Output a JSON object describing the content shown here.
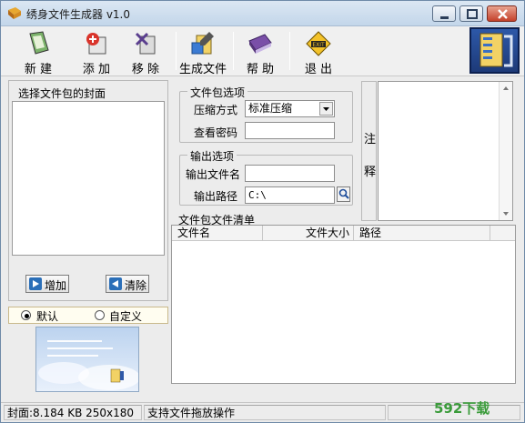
{
  "window": {
    "title": "绣身文件生成器 v1.0"
  },
  "toolbar": {
    "items": [
      {
        "label": "新 建",
        "icon": "new-document-icon"
      },
      {
        "label": "添 加",
        "icon": "add-icon"
      },
      {
        "label": "移 除",
        "icon": "remove-icon"
      },
      {
        "label": "生成文件",
        "icon": "build-icon"
      },
      {
        "label": "帮 助",
        "icon": "help-book-icon"
      },
      {
        "label": "退 出",
        "icon": "exit-sign-icon"
      }
    ],
    "logo_icon": "app-logo-icon"
  },
  "cover_panel": {
    "caption": "选择文件包的封面",
    "add_label": "增加",
    "clear_label": "清除"
  },
  "cover_mode": {
    "default_label": "默认",
    "custom_label": "自定义",
    "selected": "默认"
  },
  "package_options": {
    "legend": "文件包选项",
    "compress_label": "压缩方式",
    "compress_value": "标准压缩",
    "password_label": "查看密码",
    "password_value": ""
  },
  "output_options": {
    "legend": "输出选项",
    "filename_label": "输出文件名",
    "filename_value": "",
    "path_label": "输出路径",
    "path_value": "C:\\"
  },
  "notes": {
    "label_top": "注",
    "label_bottom": "释",
    "value": ""
  },
  "filelist": {
    "caption": "文件包文件清单",
    "columns": [
      "文件名",
      "文件大小",
      "路径"
    ],
    "rows": []
  },
  "status": {
    "cover_info": "封面:8.184 KB  250x180",
    "hint": "支持文件拖放操作"
  },
  "watermark": "592下载",
  "colors": {
    "accent_blue": "#2b6fb8",
    "close_red": "#c4412a",
    "title_bg": "#c3d6ea"
  }
}
